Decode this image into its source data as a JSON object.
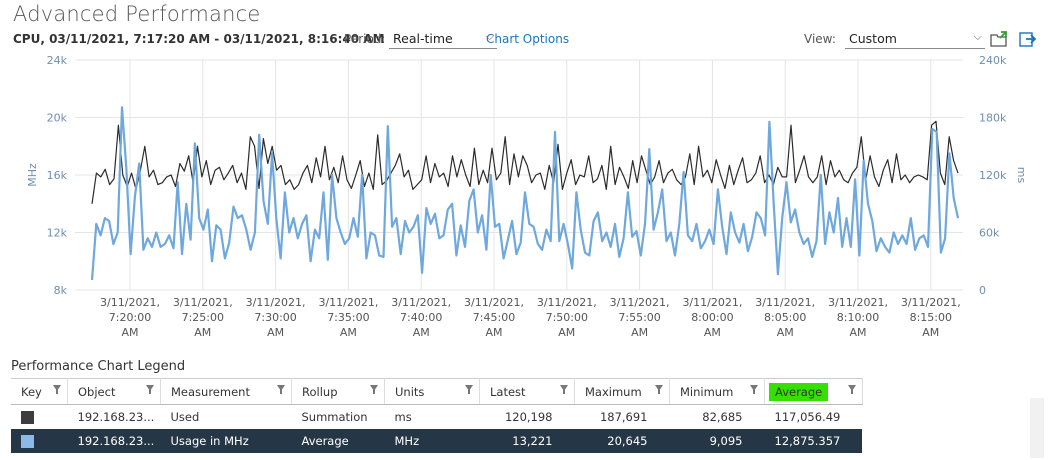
{
  "header": {
    "title": "Advanced Performance",
    "range": "CPU, 03/11/2021, 7:17:20 AM - 03/11/2021, 8:16:40 AM",
    "period_label": "Period:",
    "period_value": "Real-time",
    "chart_options": "Chart Options",
    "view_label": "View:",
    "view_value": "Custom"
  },
  "icons": {
    "export": "folder-export-icon",
    "popout": "popout-icon"
  },
  "chart_data": {
    "type": "line",
    "left_axis": {
      "label": "MHz",
      "ticks": [
        "24k",
        "20k",
        "16k",
        "12k",
        "8k"
      ],
      "min": 8000,
      "max": 24000
    },
    "right_axis": {
      "label": "ms",
      "ticks": [
        "240k",
        "180k",
        "120k",
        "60k",
        "0"
      ],
      "min": 0,
      "max": 240000
    },
    "x_ticks": [
      [
        "3/11/2021,",
        "7:20:00",
        "AM"
      ],
      [
        "3/11/2021,",
        "7:25:00",
        "AM"
      ],
      [
        "3/11/2021,",
        "7:30:00",
        "AM"
      ],
      [
        "3/11/2021,",
        "7:35:00",
        "AM"
      ],
      [
        "3/11/2021,",
        "7:40:00",
        "AM"
      ],
      [
        "3/11/2021,",
        "7:45:00",
        "AM"
      ],
      [
        "3/11/2021,",
        "7:50:00",
        "AM"
      ],
      [
        "3/11/2021,",
        "7:55:00",
        "AM"
      ],
      [
        "3/11/2021,",
        "8:00:00",
        "AM"
      ],
      [
        "3/11/2021,",
        "8:05:00",
        "AM"
      ],
      [
        "3/11/2021,",
        "8:10:00",
        "AM"
      ],
      [
        "3/11/2021,",
        "8:15:00",
        "AM"
      ]
    ],
    "series": [
      {
        "name": "Used",
        "axis": "right",
        "color": "#2b2b2b",
        "values": [
          90000,
          122000,
          118000,
          126000,
          110000,
          116000,
          172000,
          120000,
          108000,
          122000,
          105000,
          125000,
          150000,
          118000,
          125000,
          110000,
          112000,
          118000,
          120000,
          108000,
          132000,
          124000,
          140000,
          112000,
          150000,
          118000,
          135000,
          110000,
          125000,
          128000,
          115000,
          122000,
          130000,
          112000,
          122000,
          105000,
          160000,
          150000,
          106000,
          158000,
          132000,
          150000,
          125000,
          130000,
          110000,
          115000,
          105000,
          110000,
          122000,
          130000,
          112000,
          138000,
          118000,
          150000,
          115000,
          128000,
          112000,
          140000,
          115000,
          106000,
          120000,
          135000,
          108000,
          122000,
          105000,
          162000,
          110000,
          114000,
          122000,
          130000,
          142000,
          118000,
          125000,
          105000,
          110000,
          115000,
          140000,
          112000,
          132000,
          118000,
          122000,
          108000,
          140000,
          118000,
          136000,
          120000,
          108000,
          148000,
          110000,
          125000,
          112000,
          148000,
          115000,
          122000,
          160000,
          110000,
          142000,
          118000,
          140000,
          130000,
          112000,
          120000,
          122000,
          105000,
          130000,
          112000,
          152000,
          105000,
          122000,
          136000,
          110000,
          120000,
          118000,
          140000,
          112000,
          116000,
          130000,
          105000,
          150000,
          110000,
          128000,
          118000,
          106000,
          135000,
          112000,
          140000,
          125000,
          110000,
          118000,
          135000,
          112000,
          122000,
          126000,
          115000,
          110000,
          118000,
          142000,
          110000,
          150000,
          118000,
          125000,
          112000,
          136000,
          120000,
          106000,
          130000,
          110000,
          125000,
          138000,
          112000,
          115000,
          122000,
          140000,
          112000,
          120000,
          110000,
          128000,
          118000,
          118000,
          172000,
          112000,
          125000,
          140000,
          118000,
          112000,
          118000,
          140000,
          110000,
          135000,
          118000,
          125000,
          115000,
          112000,
          122000,
          128000,
          160000,
          115000,
          140000,
          118000,
          108000,
          125000,
          136000,
          112000,
          142000,
          115000,
          120000,
          112000,
          118000,
          120000,
          118000,
          115000,
          172000,
          176000,
          122000,
          110000,
          160000,
          135000,
          122000
        ]
      },
      {
        "name": "Usage in MHz",
        "axis": "left",
        "color": "#6fa8dc",
        "values": [
          8700,
          12600,
          11800,
          13000,
          12800,
          11200,
          12000,
          20700,
          16500,
          10500,
          14500,
          16800,
          10800,
          11600,
          11000,
          12000,
          11000,
          11200,
          11800,
          10900,
          15500,
          10500,
          14000,
          11500,
          18200,
          13000,
          12200,
          13600,
          10000,
          12500,
          12200,
          10200,
          11300,
          13800,
          13000,
          13200,
          12200,
          10800,
          12000,
          18800,
          14200,
          12600,
          17500,
          13000,
          10200,
          14800,
          12000,
          13000,
          11600,
          12600,
          13200,
          10000,
          12200,
          11600,
          14800,
          10100,
          16000,
          13000,
          12000,
          11200,
          11600,
          13000,
          11700,
          16000,
          10200,
          12000,
          11800,
          10400,
          10300,
          19400,
          12400,
          13000,
          10500,
          12800,
          12000,
          12400,
          13200,
          9200,
          13700,
          12600,
          13300,
          11600,
          11800,
          13600,
          14000,
          10400,
          12500,
          11000,
          14200,
          15000,
          12000,
          13200,
          10800,
          16000,
          12400,
          12600,
          10200,
          11500,
          12800,
          10500,
          11300,
          14800,
          12600,
          12400,
          11200,
          10800,
          12200,
          11400,
          19000,
          11400,
          12600,
          11200,
          9500,
          14800,
          12200,
          10600,
          10400,
          12800,
          13400,
          11400,
          12000,
          11000,
          12600,
          10300,
          11600,
          14800,
          11700,
          12100,
          10400,
          12600,
          17800,
          12200,
          13400,
          15000,
          11400,
          12000,
          10400,
          12600,
          16200,
          11800,
          11400,
          12600,
          10900,
          11400,
          12200,
          11200,
          15000,
          12400,
          10500,
          13400,
          12000,
          11300,
          12600,
          10700,
          11700,
          13400,
          13000,
          11800,
          19700,
          14000,
          9100,
          13000,
          15500,
          12700,
          13600,
          12000,
          11200,
          11600,
          10300,
          11400,
          16000,
          11200,
          13400,
          12000,
          14400,
          11000,
          13000,
          11000,
          15700,
          10400,
          17000,
          14000,
          12800,
          10700,
          11600,
          11000,
          10600,
          12000,
          11200,
          11800,
          11200,
          13000,
          10800,
          11600,
          11800,
          11000,
          19200,
          19000,
          10600,
          11600,
          17500,
          14400,
          13000
        ]
      }
    ]
  },
  "legend": {
    "title": "Performance Chart Legend",
    "columns": [
      "Key",
      "Object",
      "Measurement",
      "Rollup",
      "Units",
      "Latest",
      "Maximum",
      "Minimum",
      "Average"
    ],
    "rows": [
      {
        "key_color": "#3d3d3d",
        "object": "192.168.23...",
        "measurement": "Used",
        "rollup": "Summation",
        "units": "ms",
        "latest": "120,198",
        "maximum": "187,691",
        "minimum": "82,685",
        "average": "117,056.49"
      },
      {
        "key_color": "#8db9e8",
        "object": "192.168.23...",
        "measurement": "Usage in MHz",
        "rollup": "Average",
        "units": "MHz",
        "latest": "13,221",
        "maximum": "20,645",
        "minimum": "9,095",
        "average": "12,875.357"
      }
    ]
  }
}
